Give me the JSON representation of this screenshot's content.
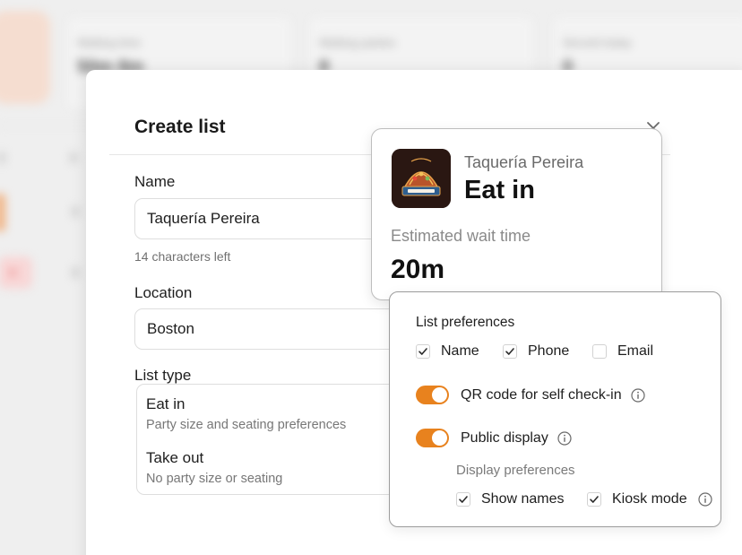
{
  "background": {
    "stats": [
      {
        "label": "Waiting time",
        "value": "50m 8m"
      },
      {
        "label": "Waiting parties",
        "value": "8"
      },
      {
        "label": "Served today",
        "value": "0"
      }
    ]
  },
  "modal": {
    "title": "Create list",
    "name_field": {
      "label": "Name",
      "value": "Taquería Pereira",
      "hint": "14 characters left"
    },
    "location_field": {
      "label": "Location",
      "value": "Boston"
    },
    "list_type": {
      "label": "List type",
      "options": [
        {
          "title": "Eat in",
          "description": "Party size and seating preferences"
        },
        {
          "title": "Take out",
          "description": "No party size or seating"
        }
      ]
    }
  },
  "store_card": {
    "logo_icon": "taqueria-logo",
    "name": "Taquería Pereira",
    "mode": "Eat in",
    "wait_label": "Estimated wait time",
    "wait_value": "20m"
  },
  "preferences": {
    "title": "List preferences",
    "fields": [
      {
        "label": "Name",
        "checked": true
      },
      {
        "label": "Phone",
        "checked": true
      },
      {
        "label": "Email",
        "checked": false
      }
    ],
    "qr_toggle": {
      "label": "QR code for self check-in",
      "on": true
    },
    "public_display_toggle": {
      "label": "Public display",
      "on": true
    },
    "display_prefs_label": "Display preferences",
    "display_prefs": [
      {
        "label": "Show names",
        "checked": true
      },
      {
        "label": "Kiosk mode",
        "checked": true
      }
    ]
  },
  "colors": {
    "accent": "#e8821e",
    "logo_bg": "#2a1712",
    "check": "#2b2b2b"
  }
}
